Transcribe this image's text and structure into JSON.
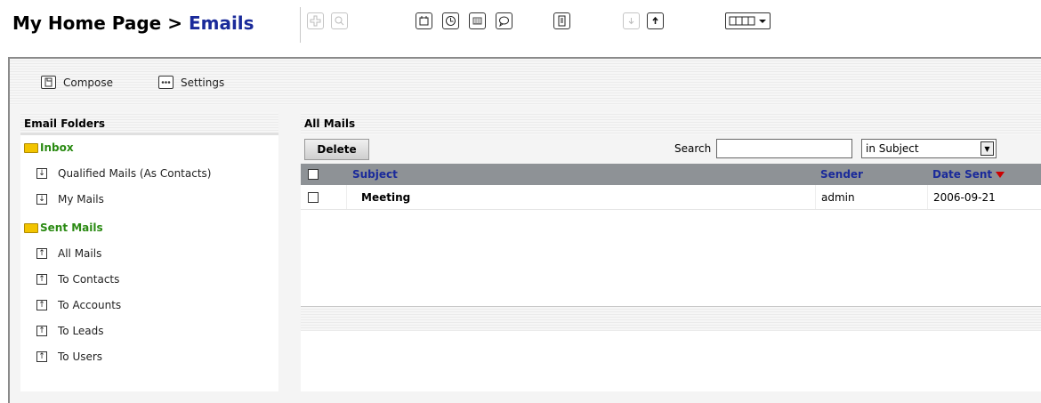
{
  "breadcrumb": {
    "parent": "My Home Page",
    "separator": ">",
    "current": "Emails"
  },
  "toolbar": {
    "icons": [
      "add-icon",
      "search-icon",
      "calendar-icon",
      "clock-icon",
      "calculator-icon",
      "chat-icon",
      "list-icon",
      "import-icon",
      "export-icon",
      "view-layout-icon"
    ]
  },
  "actions": {
    "compose": "Compose",
    "settings": "Settings"
  },
  "sidebar": {
    "title": "Email Folders",
    "inbox": {
      "label": "Inbox",
      "items": [
        {
          "label": "Qualified Mails (As Contacts)"
        },
        {
          "label": "My Mails"
        }
      ]
    },
    "sent": {
      "label": "Sent Mails",
      "items": [
        {
          "label": "All Mails"
        },
        {
          "label": "To Contacts"
        },
        {
          "label": "To Accounts"
        },
        {
          "label": "To Leads"
        },
        {
          "label": "To Users"
        }
      ]
    }
  },
  "main": {
    "title": "All Mails",
    "delete_label": "Delete",
    "search_label": "Search",
    "search_value": "",
    "search_scope": "in Subject",
    "columns": {
      "subject": "Subject",
      "sender": "Sender",
      "date": "Date Sent"
    },
    "rows": [
      {
        "subject": "Meeting",
        "sender": "admin",
        "date": "2006-09-21"
      }
    ]
  },
  "colors": {
    "accent_blue": "#1a2a9a",
    "folder_green": "#2a8a12",
    "sort_red": "#cc0000",
    "header_gray": "#8e9296"
  }
}
